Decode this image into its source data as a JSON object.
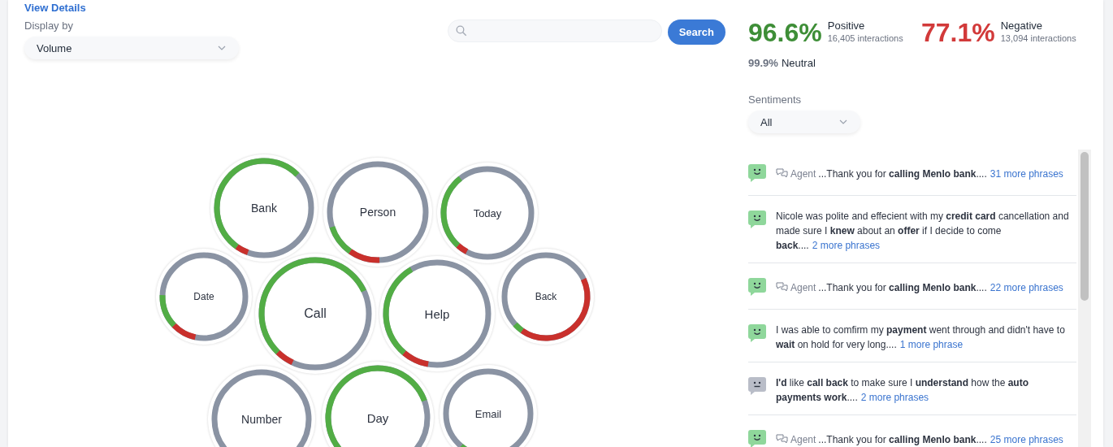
{
  "view_details_link": "View Details",
  "display_by": {
    "label": "Display by",
    "value": "Volume"
  },
  "search": {
    "button": "Search"
  },
  "topics": [
    {
      "label": "Bank"
    },
    {
      "label": "Person"
    },
    {
      "label": "Today"
    },
    {
      "label": "Date"
    },
    {
      "label": "Call"
    },
    {
      "label": "Help"
    },
    {
      "label": "Back"
    },
    {
      "label": "Number"
    },
    {
      "label": "Day"
    },
    {
      "label": "Email"
    }
  ],
  "stats": [
    {
      "kind": "positive",
      "value": "96.6%",
      "label": "Positive",
      "detail": "16,405 interactions"
    },
    {
      "kind": "negative",
      "value": "77.1%",
      "label": "Negative",
      "detail": "13,094 interactions"
    }
  ],
  "neutral": {
    "value": "99.9%",
    "label": "Neutral"
  },
  "sentiments_filter": {
    "label": "Sentiments",
    "value": "All"
  },
  "comments": [
    {
      "kind": "agent",
      "icon": {
        "kind": "smile",
        "color": "#8fd79b"
      },
      "speaker": "Agent",
      "text": "...Thank you for **calling Menlo bank**....",
      "more": "31 more phrases"
    },
    {
      "kind": "customer",
      "icon": {
        "kind": "smile",
        "color": "#8fd79b"
      },
      "text": "Nicole was polite and effecient with my **credit card** cancellation and made sure I **knew** about an **offer** if I decide to come **back**....",
      "more": "2 more phrases"
    },
    {
      "kind": "agent",
      "icon": {
        "kind": "smile",
        "color": "#8fd79b"
      },
      "speaker": "Agent",
      "text": "...Thank you for **calling Menlo bank**....",
      "more": "22 more phrases"
    },
    {
      "kind": "customer",
      "icon": {
        "kind": "smile",
        "color": "#8fd79b"
      },
      "text": "I was able to comfirm my **payment** went through and didn't have to **wait** on hold for very long....",
      "more": "1 more phrase"
    },
    {
      "kind": "customer",
      "icon": {
        "kind": "neutral",
        "color": "#b9bdc8"
      },
      "text": "**I'd** like **call back** to make sure I **understand** how the **auto payments work**....",
      "more": "2 more phrases"
    },
    {
      "kind": "agent",
      "icon": {
        "kind": "smile",
        "color": "#8fd79b"
      },
      "speaker": "Agent",
      "text": "...Thank you for **calling Menlo bank**....",
      "more": "25 more phrases"
    }
  ]
}
